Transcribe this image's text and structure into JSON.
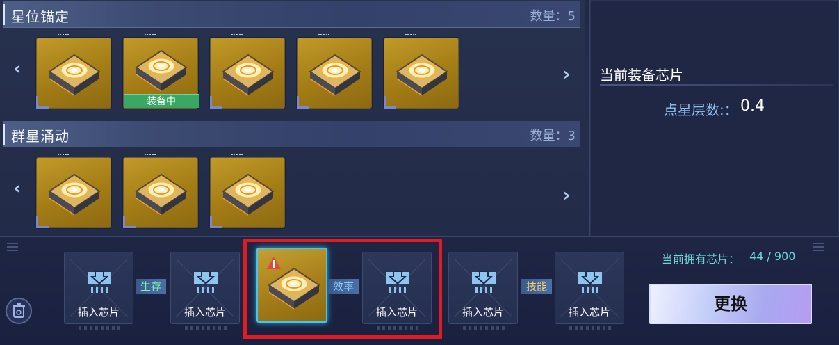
{
  "sections": [
    {
      "title": "星位锚定",
      "count": "数量：5",
      "chips": 5,
      "equipped_index": 1,
      "equipped_label": "装备中"
    },
    {
      "title": "群星涌动",
      "count": "数量：3",
      "chips": 3
    }
  ],
  "equip_panel": {
    "title": "当前装备芯片",
    "star_label": "点星层数:：",
    "star_value": "0.4"
  },
  "slots": {
    "insert_label": "插入芯片",
    "links": [
      "生存",
      "效率",
      "技能"
    ]
  },
  "owned": {
    "label": "当前拥有芯片：",
    "value": "44 / 900"
  },
  "replace_button": "更换",
  "colors": {
    "highlight": "#e01b22",
    "equipped": "#3aa862",
    "accent_cyan": "#45c6f0"
  }
}
